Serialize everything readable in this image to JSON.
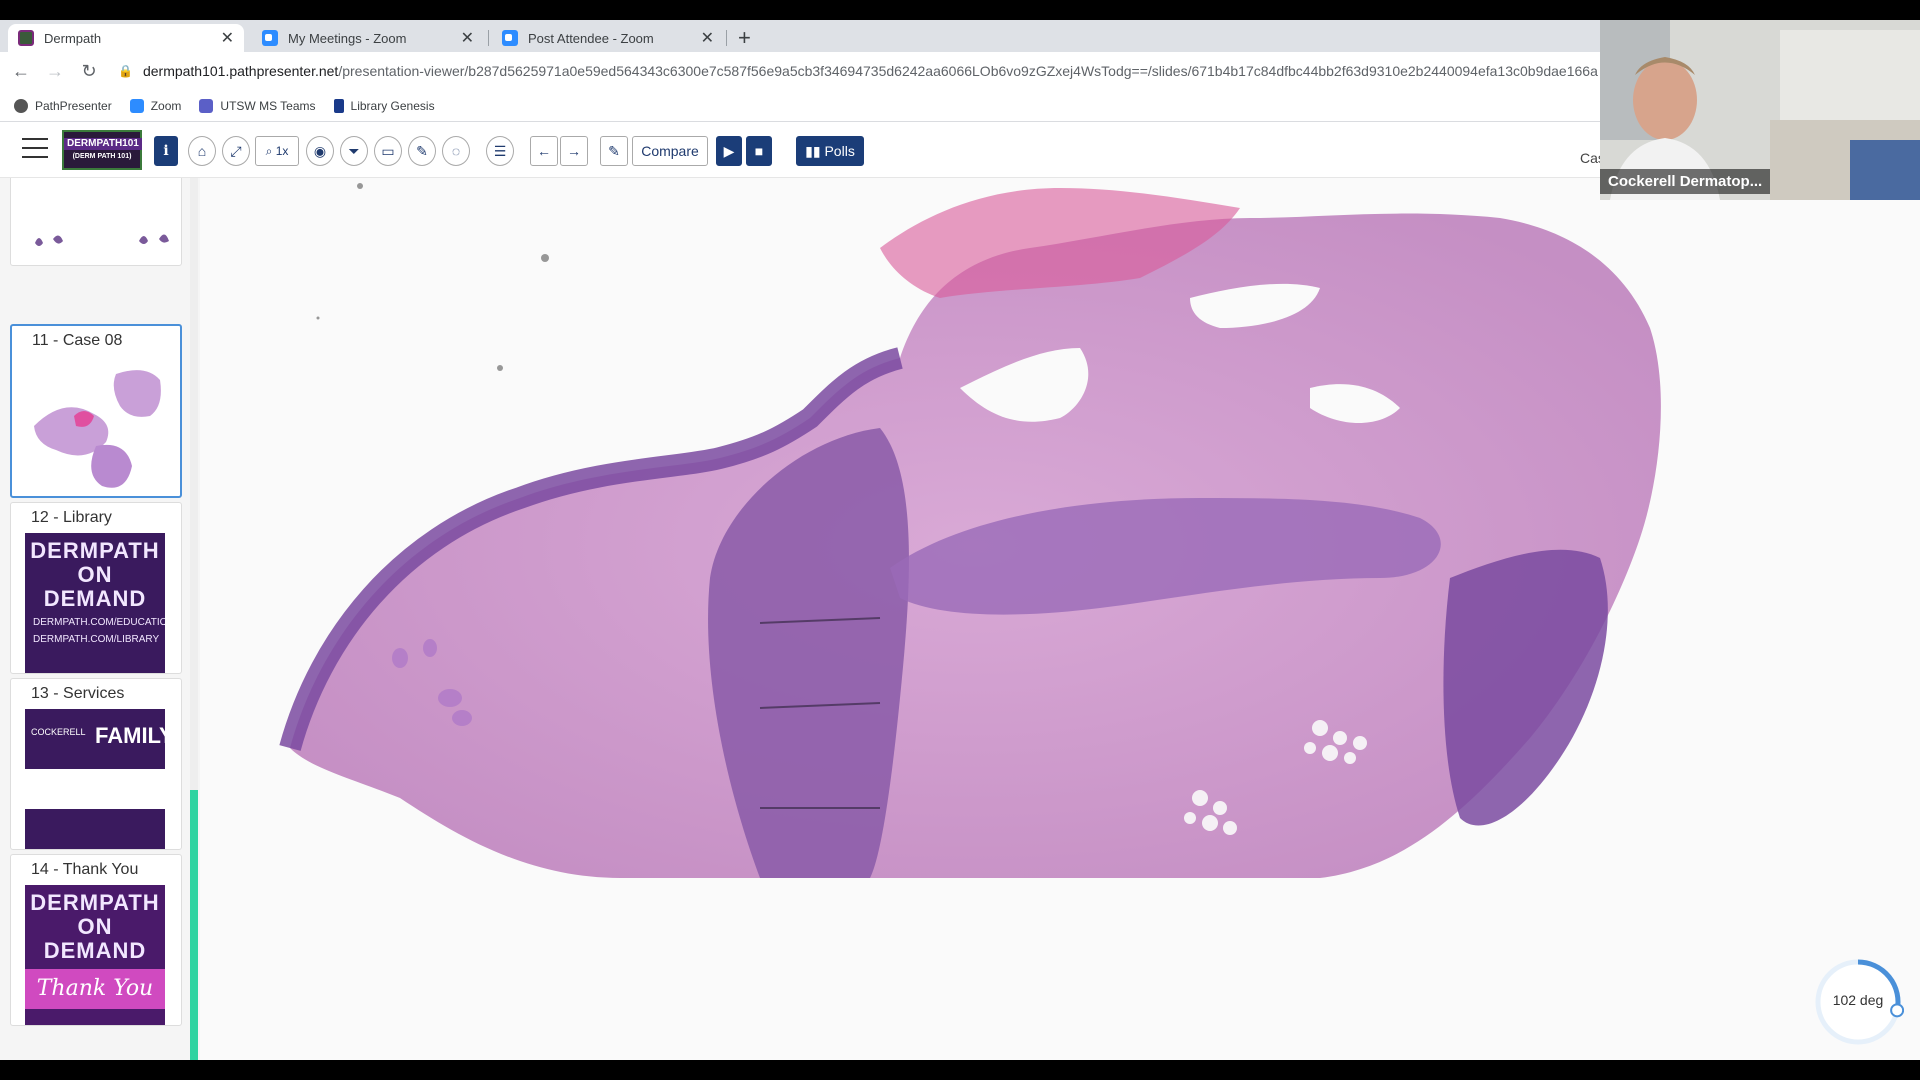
{
  "browser": {
    "tabs": [
      {
        "title": "Dermpath",
        "active": true
      },
      {
        "title": "My Meetings - Zoom",
        "active": false
      },
      {
        "title": "Post Attendee - Zoom",
        "active": false
      }
    ],
    "url_host": "dermpath101.pathpresenter.net",
    "url_path": "/presentation-viewer/b287d5625971a0e59ed564343c6300e7c587f56e9a5cb3f34694735d6242aa6066LOb6vo9zGZxej4WsTodg==/slides/671b4b17c84dfbc44bb2f63d9310e2b2440094efa13c0b9dae166a...",
    "bookmarks": [
      "PathPresenter",
      "Zoom",
      "UTSW MS Teams",
      "Library Genesis"
    ]
  },
  "app": {
    "logo_line1": "DERMPATH101",
    "logo_line2": "(DERM PATH 101)",
    "zoom_level": "1x",
    "compare_label": "Compare",
    "polls_label": "Polls",
    "cas_text": "Cas"
  },
  "sidebar": {
    "slides": [
      {
        "label": "11 - Case 08"
      },
      {
        "label": "12 - Library",
        "promo_big": "DERMPATH ON DEMAND",
        "promo_line1": "DERMPATH.COM/EDUCATION",
        "promo_line2": "DERMPATH.COM/LIBRARY"
      },
      {
        "label": "13 - Services",
        "brand": "FAMILY",
        "brand_small": "COCKERELL"
      },
      {
        "label": "14 - Thank You",
        "promo_big": "DERMPATH ON DEMAND",
        "thanks": "Thank You"
      }
    ]
  },
  "viewer": {
    "rotation_label": "102 deg",
    "rotation_degrees": 102
  },
  "video": {
    "participant_name": "Cockerell Dermatop..."
  },
  "colors": {
    "toolbar_blue": "#1b3d78",
    "scroll_accent": "#2ed3a0",
    "tissue_pink": "#d8a2cf",
    "tissue_purple": "#8a5aa8"
  }
}
